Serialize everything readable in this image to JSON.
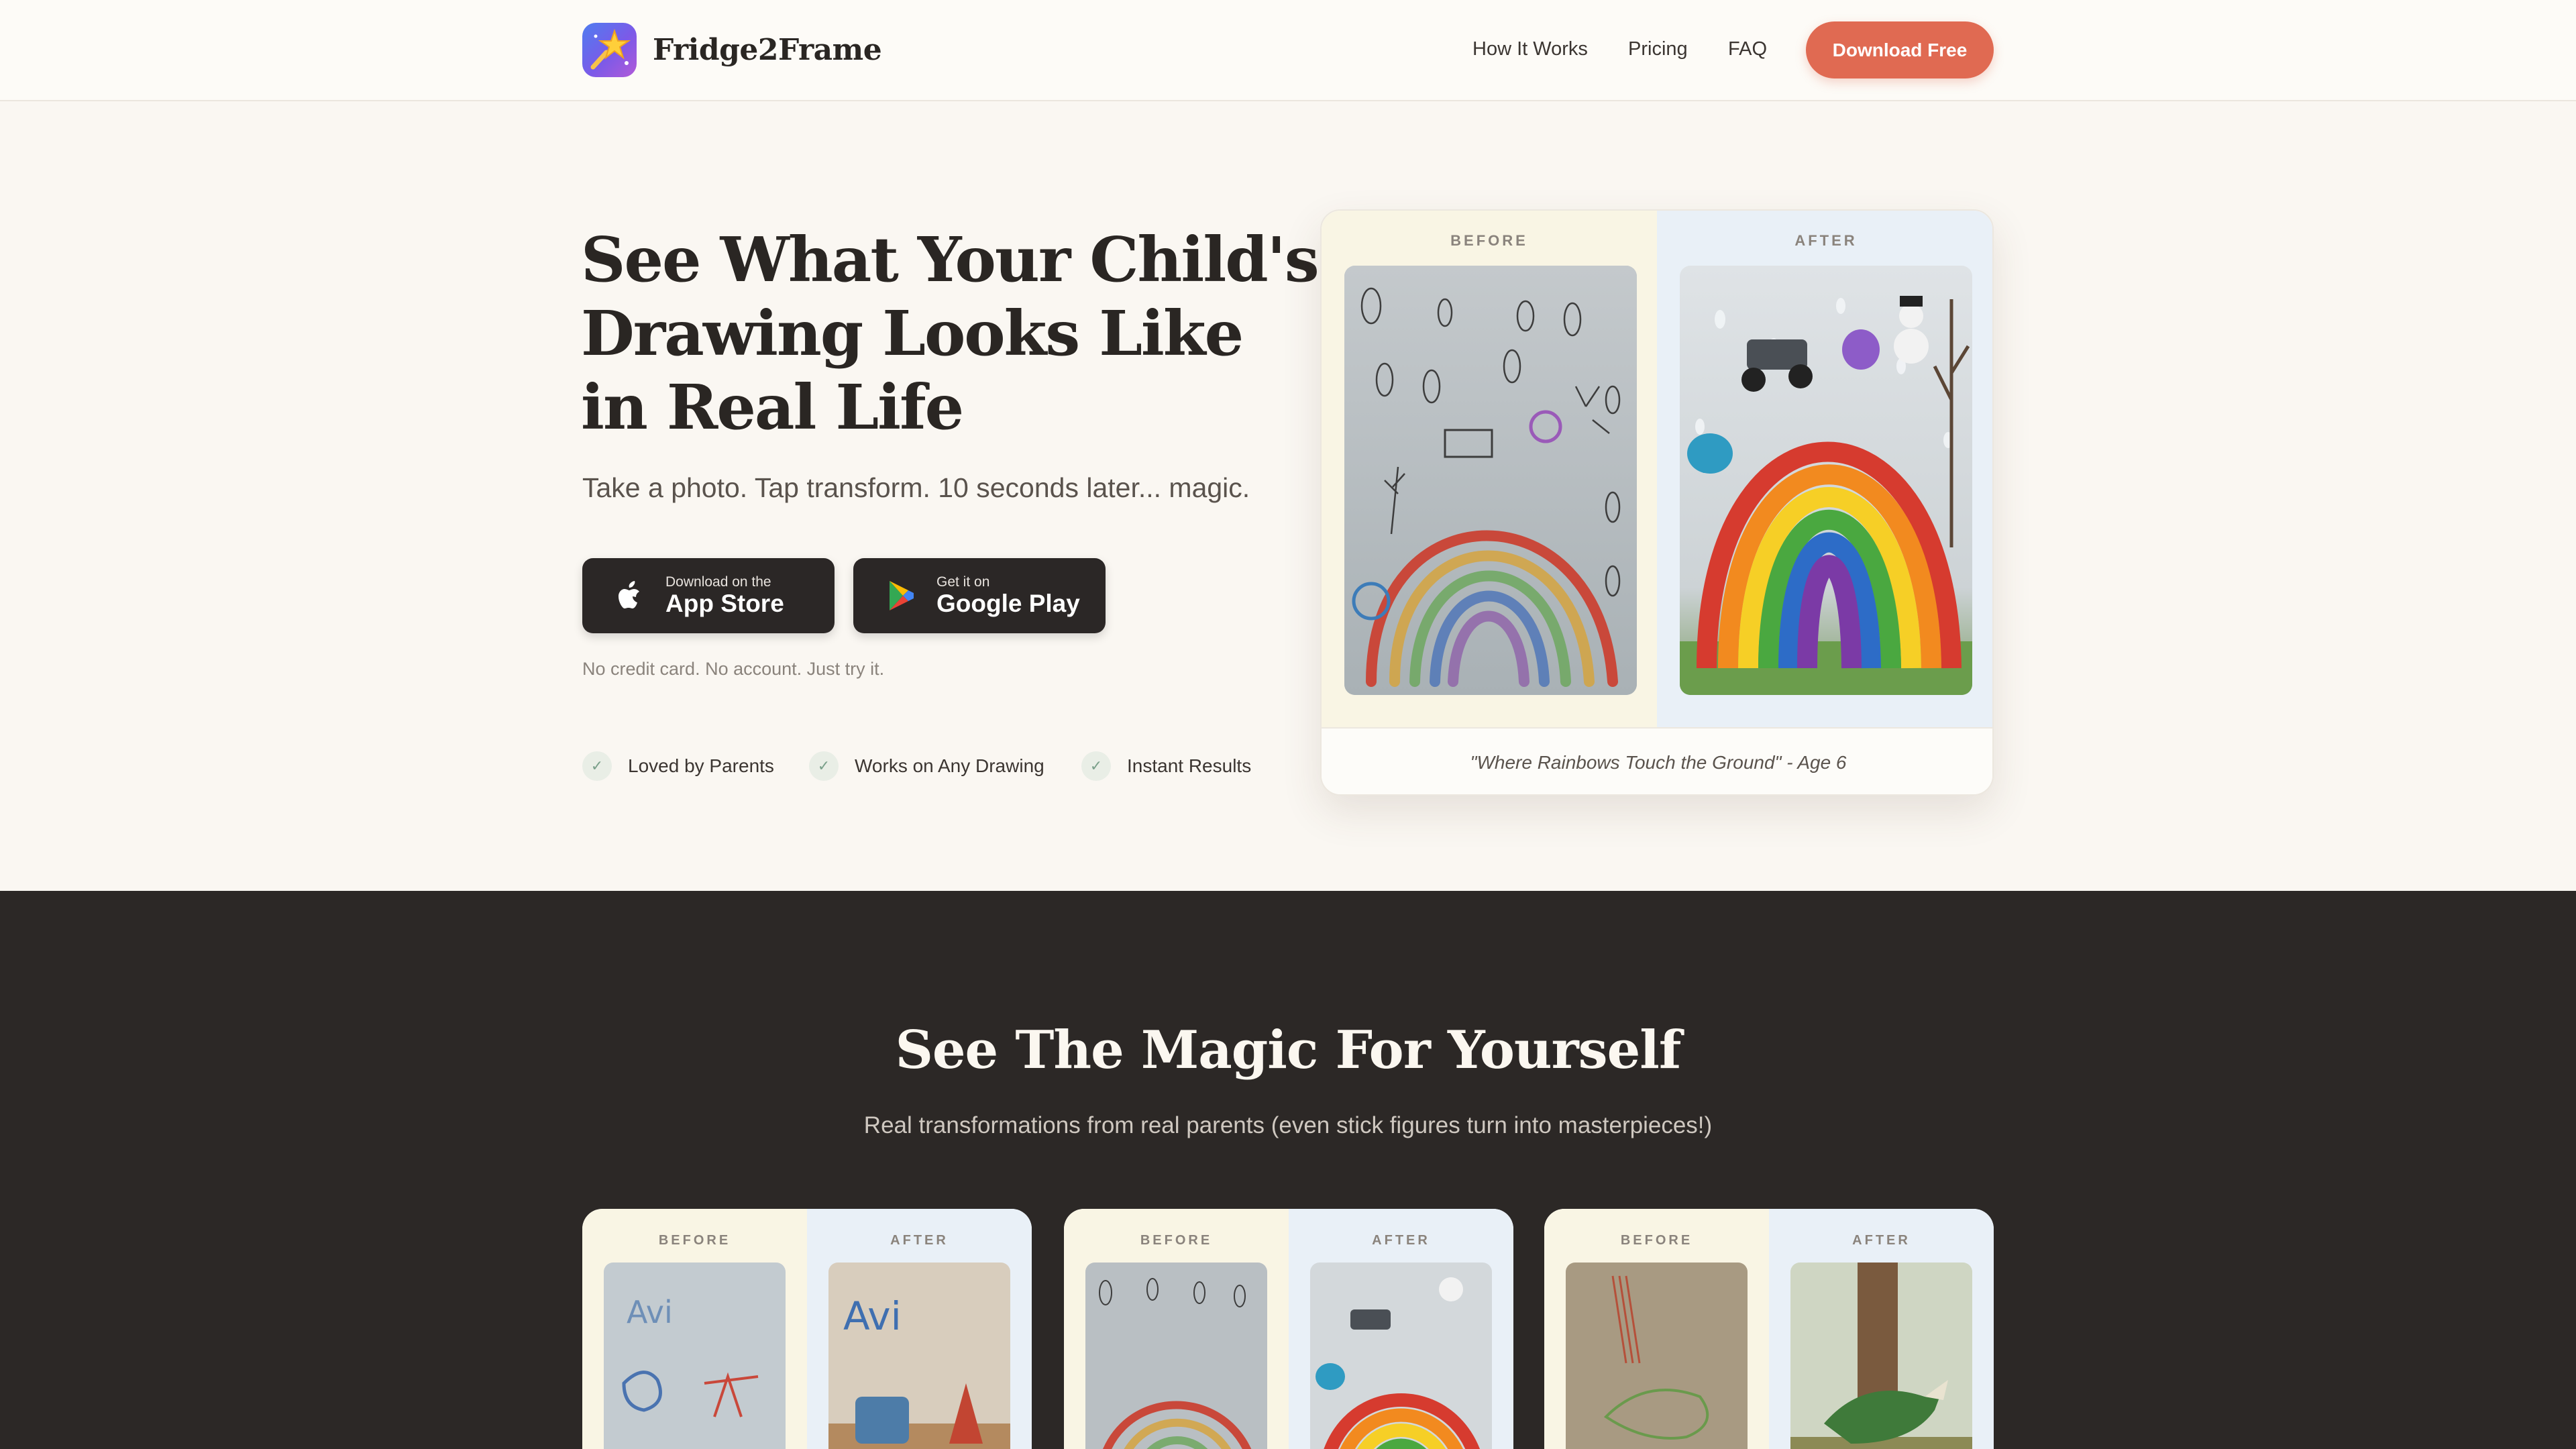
{
  "header": {
    "logo_text": "Fridge2Frame",
    "nav": [
      "How It Works",
      "Pricing",
      "FAQ"
    ],
    "cta_label": "Download Free"
  },
  "hero": {
    "title_lines": [
      "See What Your Child's",
      "Drawing Looks Like",
      "in Real Life"
    ],
    "subtitle": "Take a photo. Tap transform. 10 seconds later... magic.",
    "app_store": {
      "small": "Download on the",
      "big": "App Store"
    },
    "google_play": {
      "small": "Get it on",
      "big": "Google Play"
    },
    "note": "No credit card. No account. Just try it.",
    "features": [
      "Loved by Parents",
      "Works on Any Drawing",
      "Instant Results"
    ],
    "card": {
      "before_label": "BEFORE",
      "after_label": "AFTER",
      "caption": "\"Where Rainbows Touch the Ground\" - Age 6"
    }
  },
  "showcase": {
    "title": "See The Magic For Yourself",
    "subtitle": "Real transformations from real parents (even stick figures turn into masterpieces!)",
    "cards": [
      {
        "before_label": "BEFORE",
        "after_label": "AFTER",
        "before_text": "Avi",
        "after_text": "Avi"
      },
      {
        "before_label": "BEFORE",
        "after_label": "AFTER"
      },
      {
        "before_label": "BEFORE",
        "after_label": "AFTER"
      }
    ]
  },
  "colors": {
    "accent": "#e06a52",
    "background": "#faf7f2",
    "dark_section": "#2c2826",
    "store_button": "#2b2726"
  },
  "icons": [
    "app-logo-icon",
    "apple-icon",
    "google-play-icon",
    "check-icon"
  ]
}
